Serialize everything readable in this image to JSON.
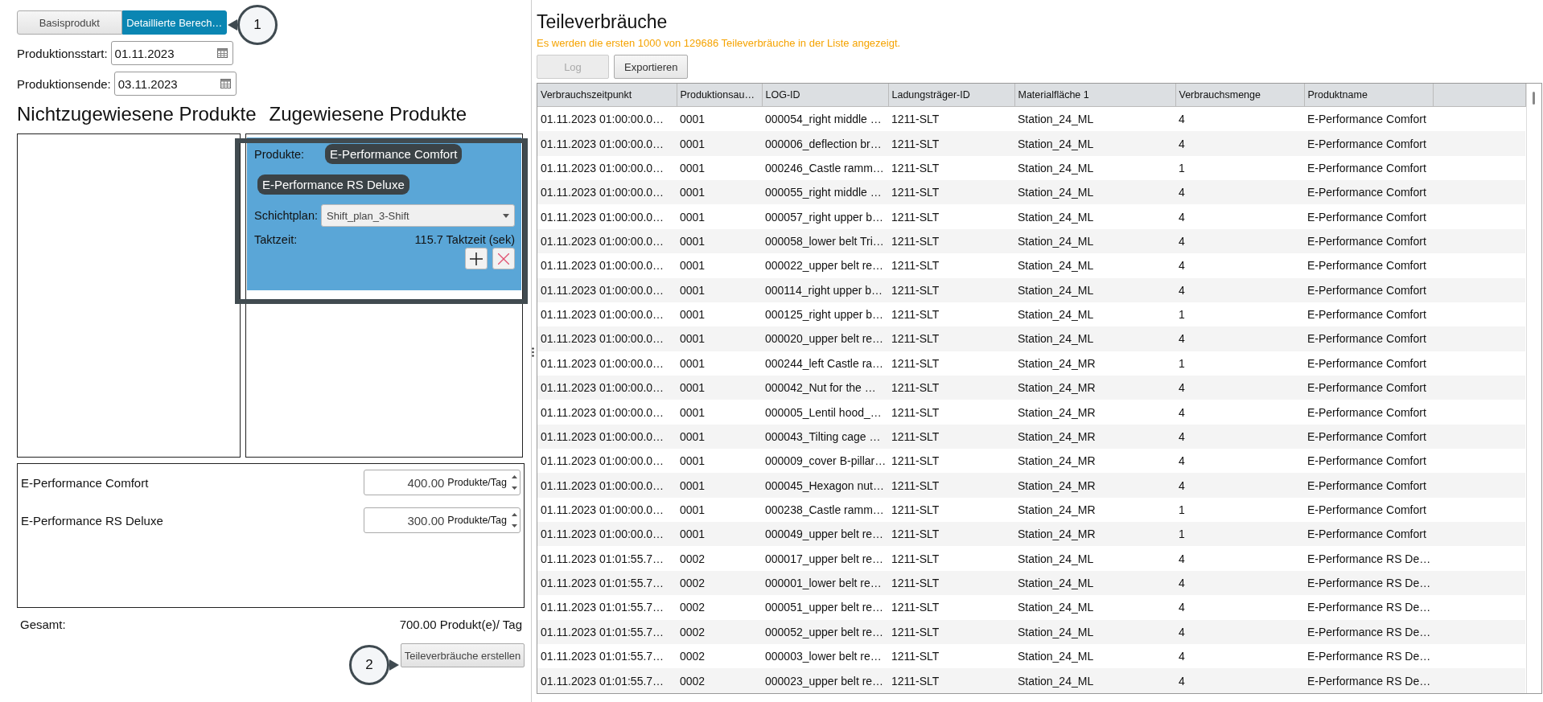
{
  "mode_tabs": [
    {
      "label": "Basisprodukt",
      "selected": false
    },
    {
      "label": "Detaillierte Berech…",
      "selected": true
    }
  ],
  "production_start": {
    "label": "Produktionsstart:",
    "value": "01.11.2023"
  },
  "production_end": {
    "label": "Produktionsende:",
    "value": "03.11.2023"
  },
  "unassigned_heading": "Nichtzugewiesene Produkte",
  "assigned_heading": "Zugewiesene Produkte",
  "assignment_card": {
    "products_label": "Produkte:",
    "products": [
      "E-Performance Comfort",
      "E-Performance RS Deluxe"
    ],
    "shift_plan_label": "Schichtplan:",
    "shift_plan_value": "Shift_plan_3-Shift",
    "takt_label": "Taktzeit:",
    "takt_value": "115.7 Taktzeit (sek)"
  },
  "quantities": [
    {
      "name": "E-Performance Comfort",
      "value": "400.00",
      "unit": "Produkte/Tag"
    },
    {
      "name": "E-Performance RS Deluxe",
      "value": "300.00",
      "unit": "Produkte/Tag"
    }
  ],
  "total": {
    "label": "Gesamt:",
    "value": "700.00 Produkt(e)/ Tag"
  },
  "create_button": "Teileverbräuche erstellen",
  "callouts": [
    "1",
    "2"
  ],
  "consumption": {
    "title": "Teileverbräuche",
    "notice": "Es werden die ersten 1000 von 129686 Teileverbräuche in der Liste angezeigt.",
    "buttons": [
      {
        "label": "Log",
        "disabled": true
      },
      {
        "label": "Exportieren",
        "disabled": false
      }
    ],
    "columns": [
      "Verbrauchszeitpunkt",
      "Produktionsau…",
      "LOG-ID",
      "Ladungsträger-ID",
      "Materialfläche 1",
      "Verbrauchsmenge",
      "Produktname"
    ],
    "rows": [
      [
        "01.11.2023 01:00:00.0…",
        "0001",
        "000054_right middle …",
        "1211-SLT",
        "Station_24_ML",
        "4",
        "E-Performance Comfort"
      ],
      [
        "01.11.2023 01:00:00.0…",
        "0001",
        "000006_deflection br…",
        "1211-SLT",
        "Station_24_ML",
        "4",
        "E-Performance Comfort"
      ],
      [
        "01.11.2023 01:00:00.0…",
        "0001",
        "000246_Castle ramm…",
        "1211-SLT",
        "Station_24_ML",
        "1",
        "E-Performance Comfort"
      ],
      [
        "01.11.2023 01:00:00.0…",
        "0001",
        "000055_right middle …",
        "1211-SLT",
        "Station_24_ML",
        "4",
        "E-Performance Comfort"
      ],
      [
        "01.11.2023 01:00:00.0…",
        "0001",
        "000057_right upper b…",
        "1211-SLT",
        "Station_24_ML",
        "4",
        "E-Performance Comfort"
      ],
      [
        "01.11.2023 01:00:00.0…",
        "0001",
        "000058_lower belt Tri…",
        "1211-SLT",
        "Station_24_ML",
        "4",
        "E-Performance Comfort"
      ],
      [
        "01.11.2023 01:00:00.0…",
        "0001",
        "000022_upper belt re…",
        "1211-SLT",
        "Station_24_ML",
        "4",
        "E-Performance Comfort"
      ],
      [
        "01.11.2023 01:00:00.0…",
        "0001",
        "000114_right upper b…",
        "1211-SLT",
        "Station_24_ML",
        "4",
        "E-Performance Comfort"
      ],
      [
        "01.11.2023 01:00:00.0…",
        "0001",
        "000125_right upper b…",
        "1211-SLT",
        "Station_24_ML",
        "1",
        "E-Performance Comfort"
      ],
      [
        "01.11.2023 01:00:00.0…",
        "0001",
        "000020_upper belt re…",
        "1211-SLT",
        "Station_24_ML",
        "4",
        "E-Performance Comfort"
      ],
      [
        "01.11.2023 01:00:00.0…",
        "0001",
        "000244_left Castle ra…",
        "1211-SLT",
        "Station_24_MR",
        "1",
        "E-Performance Comfort"
      ],
      [
        "01.11.2023 01:00:00.0…",
        "0001",
        "000042_Nut for the …",
        "1211-SLT",
        "Station_24_MR",
        "4",
        "E-Performance Comfort"
      ],
      [
        "01.11.2023 01:00:00.0…",
        "0001",
        "000005_Lentil hood_…",
        "1211-SLT",
        "Station_24_MR",
        "4",
        "E-Performance Comfort"
      ],
      [
        "01.11.2023 01:00:00.0…",
        "0001",
        "000043_Tilting cage …",
        "1211-SLT",
        "Station_24_MR",
        "4",
        "E-Performance Comfort"
      ],
      [
        "01.11.2023 01:00:00.0…",
        "0001",
        "000009_cover B-pillar…",
        "1211-SLT",
        "Station_24_MR",
        "4",
        "E-Performance Comfort"
      ],
      [
        "01.11.2023 01:00:00.0…",
        "0001",
        "000045_Hexagon nut…",
        "1211-SLT",
        "Station_24_MR",
        "4",
        "E-Performance Comfort"
      ],
      [
        "01.11.2023 01:00:00.0…",
        "0001",
        "000238_Castle ramm…",
        "1211-SLT",
        "Station_24_MR",
        "1",
        "E-Performance Comfort"
      ],
      [
        "01.11.2023 01:00:00.0…",
        "0001",
        "000049_upper belt re…",
        "1211-SLT",
        "Station_24_MR",
        "1",
        "E-Performance Comfort"
      ],
      [
        "01.11.2023 01:01:55.7…",
        "0002",
        "000017_upper belt re…",
        "1211-SLT",
        "Station_24_ML",
        "4",
        "E-Performance RS De…"
      ],
      [
        "01.11.2023 01:01:55.7…",
        "0002",
        "000001_lower belt re…",
        "1211-SLT",
        "Station_24_ML",
        "4",
        "E-Performance RS De…"
      ],
      [
        "01.11.2023 01:01:55.7…",
        "0002",
        "000051_upper belt re…",
        "1211-SLT",
        "Station_24_ML",
        "4",
        "E-Performance RS De…"
      ],
      [
        "01.11.2023 01:01:55.7…",
        "0002",
        "000052_upper belt re…",
        "1211-SLT",
        "Station_24_ML",
        "4",
        "E-Performance RS De…"
      ],
      [
        "01.11.2023 01:01:55.7…",
        "0002",
        "000003_lower belt re…",
        "1211-SLT",
        "Station_24_ML",
        "4",
        "E-Performance RS De…"
      ],
      [
        "01.11.2023 01:01:55.7…",
        "0002",
        "000023_upper belt re…",
        "1211-SLT",
        "Station_24_ML",
        "4",
        "E-Performance RS De…"
      ]
    ]
  }
}
